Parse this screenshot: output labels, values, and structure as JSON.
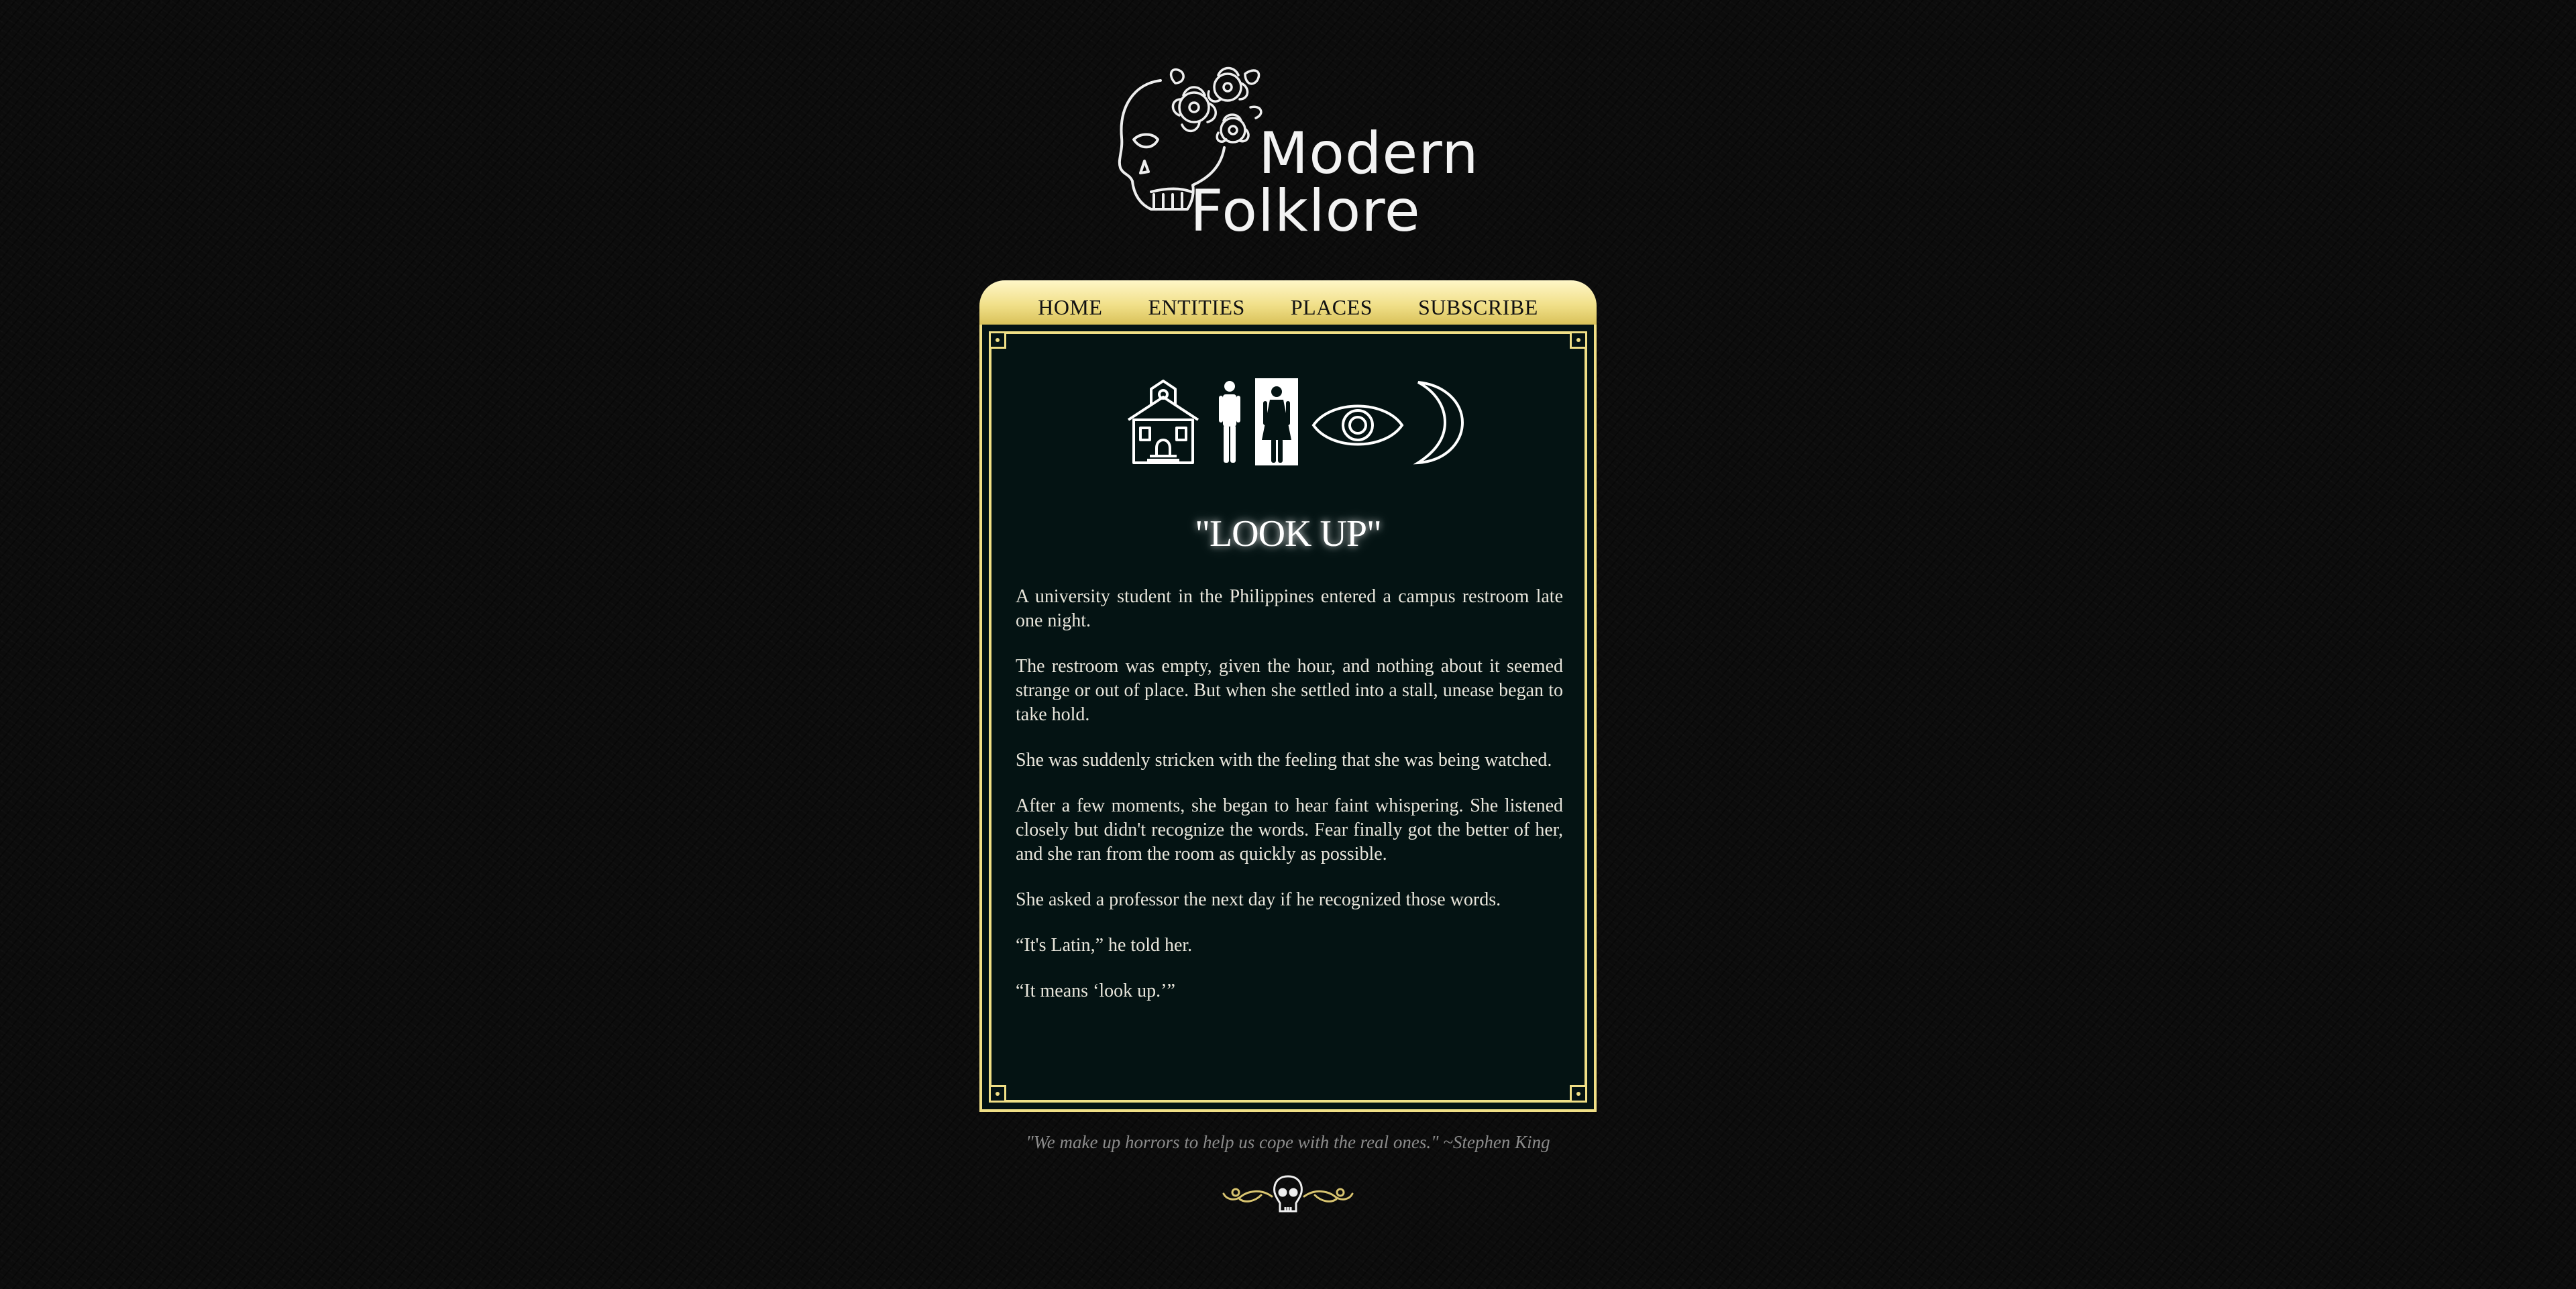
{
  "logo": {
    "line1": "Modern",
    "line2": "Folklore"
  },
  "nav": {
    "items": [
      {
        "label": "HOME"
      },
      {
        "label": "ENTITIES"
      },
      {
        "label": "PLACES"
      },
      {
        "label": "SUBSCRIBE"
      }
    ]
  },
  "story": {
    "icons": [
      "schoolhouse-icon",
      "restroom-icon",
      "eye-icon",
      "crescent-moon-icon"
    ],
    "title": "\"LOOK UP\"",
    "paragraphs": [
      "A university student in the Philippines entered a campus restroom late one night.",
      "The restroom was empty, given the hour, and nothing about it seemed strange or out of place. But when she settled into a stall, unease began to take hold.",
      "She was suddenly stricken with the feeling that she was being watched.",
      "After a few moments, she began to hear faint whispering. She listened closely but didn't recognize the words. Fear finally got the better of her, and she ran from the room as quickly as possible.",
      "She asked a professor the next day if he recognized those words.",
      "“It's Latin,” he told her.",
      "“It means ‘look up.’”"
    ]
  },
  "footer": {
    "quote": "\"We make up horrors to help us cope with the real ones.\" ~Stephen King"
  },
  "colors": {
    "gold": "#f0df86",
    "board": "#041313",
    "background": "#0c0c0c"
  }
}
